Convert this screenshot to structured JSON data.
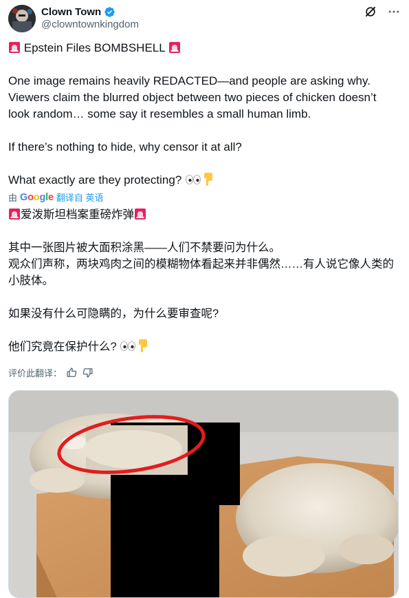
{
  "author": {
    "display_name": "Clown Town",
    "handle": "@clowntownkingdom",
    "verified": true,
    "accent_color": "#1d9bf0"
  },
  "header_icons": [
    "grok-icon",
    "more-icon"
  ],
  "tweet": {
    "headline": "Epstein Files BOMBSHELL",
    "para1": "One image remains heavily REDACTED—and people are asking why. Viewers claim the blurred object between two pieces of chicken doesn’t look random… some say it resembles a small human limb.",
    "para2": "If there’s nothing to hide, why censor it at all?",
    "para3": "What exactly are they protecting?"
  },
  "translation_bar": {
    "prefix": "由",
    "provider": "Google",
    "link": "翻译自 英语"
  },
  "translated": {
    "headline": "爱泼斯坦档案重磅炸弹",
    "para1": "其中一张图片被大面积涂黑——人们不禁要问为什么。\n观众们声称，两块鸡肉之间的模糊物体看起来并非偶然……有人说它像人类的小肢体。",
    "para2": "如果没有什么可隐瞒的，为什么要审查呢?",
    "para3": "他们究竟在保护什么?"
  },
  "rate_translation": {
    "label": "评价此翻译："
  },
  "media": {
    "description_icon": "redacted-photo"
  }
}
